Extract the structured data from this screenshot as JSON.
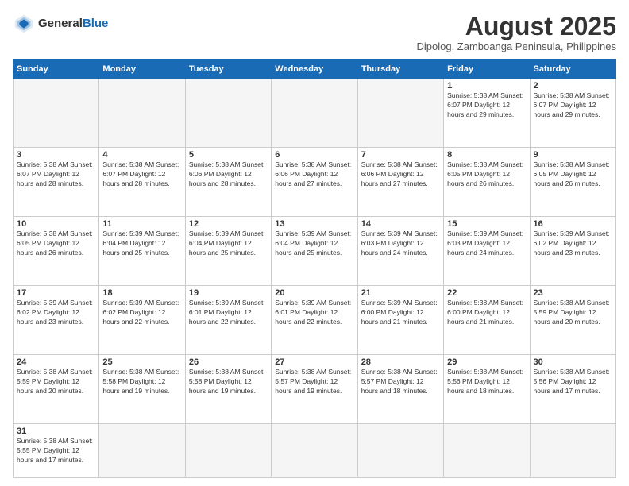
{
  "header": {
    "logo_general": "General",
    "logo_blue": "Blue",
    "month_title": "August 2025",
    "subtitle": "Dipolog, Zamboanga Peninsula, Philippines"
  },
  "days_of_week": [
    "Sunday",
    "Monday",
    "Tuesday",
    "Wednesday",
    "Thursday",
    "Friday",
    "Saturday"
  ],
  "weeks": [
    [
      {
        "day": "",
        "info": ""
      },
      {
        "day": "",
        "info": ""
      },
      {
        "day": "",
        "info": ""
      },
      {
        "day": "",
        "info": ""
      },
      {
        "day": "",
        "info": ""
      },
      {
        "day": "1",
        "info": "Sunrise: 5:38 AM\nSunset: 6:07 PM\nDaylight: 12 hours and 29 minutes."
      },
      {
        "day": "2",
        "info": "Sunrise: 5:38 AM\nSunset: 6:07 PM\nDaylight: 12 hours and 29 minutes."
      }
    ],
    [
      {
        "day": "3",
        "info": "Sunrise: 5:38 AM\nSunset: 6:07 PM\nDaylight: 12 hours and 28 minutes."
      },
      {
        "day": "4",
        "info": "Sunrise: 5:38 AM\nSunset: 6:07 PM\nDaylight: 12 hours and 28 minutes."
      },
      {
        "day": "5",
        "info": "Sunrise: 5:38 AM\nSunset: 6:06 PM\nDaylight: 12 hours and 28 minutes."
      },
      {
        "day": "6",
        "info": "Sunrise: 5:38 AM\nSunset: 6:06 PM\nDaylight: 12 hours and 27 minutes."
      },
      {
        "day": "7",
        "info": "Sunrise: 5:38 AM\nSunset: 6:06 PM\nDaylight: 12 hours and 27 minutes."
      },
      {
        "day": "8",
        "info": "Sunrise: 5:38 AM\nSunset: 6:05 PM\nDaylight: 12 hours and 26 minutes."
      },
      {
        "day": "9",
        "info": "Sunrise: 5:38 AM\nSunset: 6:05 PM\nDaylight: 12 hours and 26 minutes."
      }
    ],
    [
      {
        "day": "10",
        "info": "Sunrise: 5:38 AM\nSunset: 6:05 PM\nDaylight: 12 hours and 26 minutes."
      },
      {
        "day": "11",
        "info": "Sunrise: 5:39 AM\nSunset: 6:04 PM\nDaylight: 12 hours and 25 minutes."
      },
      {
        "day": "12",
        "info": "Sunrise: 5:39 AM\nSunset: 6:04 PM\nDaylight: 12 hours and 25 minutes."
      },
      {
        "day": "13",
        "info": "Sunrise: 5:39 AM\nSunset: 6:04 PM\nDaylight: 12 hours and 25 minutes."
      },
      {
        "day": "14",
        "info": "Sunrise: 5:39 AM\nSunset: 6:03 PM\nDaylight: 12 hours and 24 minutes."
      },
      {
        "day": "15",
        "info": "Sunrise: 5:39 AM\nSunset: 6:03 PM\nDaylight: 12 hours and 24 minutes."
      },
      {
        "day": "16",
        "info": "Sunrise: 5:39 AM\nSunset: 6:02 PM\nDaylight: 12 hours and 23 minutes."
      }
    ],
    [
      {
        "day": "17",
        "info": "Sunrise: 5:39 AM\nSunset: 6:02 PM\nDaylight: 12 hours and 23 minutes."
      },
      {
        "day": "18",
        "info": "Sunrise: 5:39 AM\nSunset: 6:02 PM\nDaylight: 12 hours and 22 minutes."
      },
      {
        "day": "19",
        "info": "Sunrise: 5:39 AM\nSunset: 6:01 PM\nDaylight: 12 hours and 22 minutes."
      },
      {
        "day": "20",
        "info": "Sunrise: 5:39 AM\nSunset: 6:01 PM\nDaylight: 12 hours and 22 minutes."
      },
      {
        "day": "21",
        "info": "Sunrise: 5:39 AM\nSunset: 6:00 PM\nDaylight: 12 hours and 21 minutes."
      },
      {
        "day": "22",
        "info": "Sunrise: 5:38 AM\nSunset: 6:00 PM\nDaylight: 12 hours and 21 minutes."
      },
      {
        "day": "23",
        "info": "Sunrise: 5:38 AM\nSunset: 5:59 PM\nDaylight: 12 hours and 20 minutes."
      }
    ],
    [
      {
        "day": "24",
        "info": "Sunrise: 5:38 AM\nSunset: 5:59 PM\nDaylight: 12 hours and 20 minutes."
      },
      {
        "day": "25",
        "info": "Sunrise: 5:38 AM\nSunset: 5:58 PM\nDaylight: 12 hours and 19 minutes."
      },
      {
        "day": "26",
        "info": "Sunrise: 5:38 AM\nSunset: 5:58 PM\nDaylight: 12 hours and 19 minutes."
      },
      {
        "day": "27",
        "info": "Sunrise: 5:38 AM\nSunset: 5:57 PM\nDaylight: 12 hours and 19 minutes."
      },
      {
        "day": "28",
        "info": "Sunrise: 5:38 AM\nSunset: 5:57 PM\nDaylight: 12 hours and 18 minutes."
      },
      {
        "day": "29",
        "info": "Sunrise: 5:38 AM\nSunset: 5:56 PM\nDaylight: 12 hours and 18 minutes."
      },
      {
        "day": "30",
        "info": "Sunrise: 5:38 AM\nSunset: 5:56 PM\nDaylight: 12 hours and 17 minutes."
      }
    ],
    [
      {
        "day": "31",
        "info": "Sunrise: 5:38 AM\nSunset: 5:55 PM\nDaylight: 12 hours and 17 minutes."
      },
      {
        "day": "",
        "info": ""
      },
      {
        "day": "",
        "info": ""
      },
      {
        "day": "",
        "info": ""
      },
      {
        "day": "",
        "info": ""
      },
      {
        "day": "",
        "info": ""
      },
      {
        "day": "",
        "info": ""
      }
    ]
  ]
}
